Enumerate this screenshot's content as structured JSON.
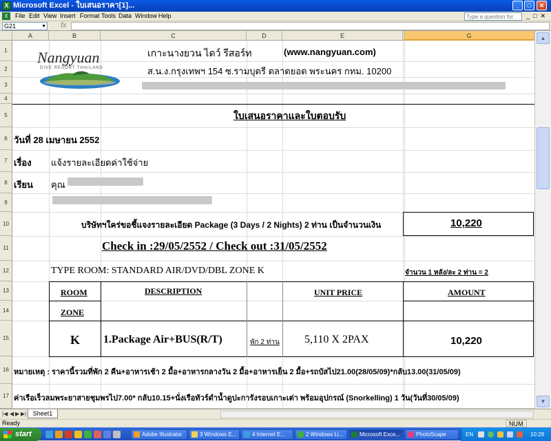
{
  "window": {
    "title": "Microsoft Excel - ใบเสนอราคา[1]..."
  },
  "menu": {
    "items": [
      "File",
      "Edit",
      "View",
      "Insert",
      "Format",
      "Tools",
      "Data",
      "Window",
      "Help"
    ],
    "help_placeholder": "Type a question for help"
  },
  "formula": {
    "cell_ref": "G21",
    "fx": "fx",
    "content": ""
  },
  "columns": [
    "A",
    "B",
    "C",
    "D",
    "E",
    "F",
    "G"
  ],
  "rows": [
    "1",
    "2",
    "3",
    "4",
    "5",
    "6",
    "7",
    "8",
    "9",
    "10",
    "11",
    "12",
    "13",
    "14",
    "15",
    "16",
    "17"
  ],
  "company": {
    "logo_text": "Nangyuan",
    "logo_sub": "DIVE RESORT THAILAND",
    "name": "เกาะนางยวน ไดว์ รีสอร์ท",
    "website": "(www.nangyuan.com)",
    "address": "ส.น.ง.กรุงเทพฯ 154 ซ.รามบุตรี ตลาดยอด พระนคร กทม. 10200"
  },
  "doc": {
    "heading": "ใบเสนอราคาและใบตอบรับ",
    "date": "วันที่ 28 เมษายน 2552",
    "subject_label": "เรื่อง",
    "subject": "แจ้งรายละเอียดค่าใช้จ่าย",
    "to_label": "เรียน",
    "to_prefix": "คุณ",
    "intro": "บริษัทฯใคร่ขอชี้แจงรายละเอียด Package (3 Days / 2 Nights) 2 ท่าน เป็นจำนวนเงิน",
    "total": "10,220",
    "checkin": "Check in :29/05/2552 / Check out :31/05/2552",
    "room_type": "TYPE ROOM: STANDARD AIR/DVD/DBL ZONE K",
    "room_count": "จำนวน 1 หลัง/ละ 2 ท่าน = 2"
  },
  "table": {
    "headers": {
      "room": "ROOM",
      "zone": "ZONE",
      "description": "DESCRIPTION",
      "unit_price": "UNIT PRICE",
      "amount": "AMOUNT"
    },
    "row": {
      "room": "K",
      "description": "1.Package Air+BUS(R/T)",
      "note": "พัก 2 ท่าน",
      "unit_price": "5,110 X 2PAX",
      "amount": "10,220"
    }
  },
  "notes": {
    "line16": "หมายเหตุ : ราคานี้รวมที่พัก 2 คืน+อาหารเช้า 2 มื้อ+อาหารกลางวัน 2 มื้อ+อาหารเย็น 2 มื้อ+รถบัสไป21.00(28/05/09)*กลับ13.00(31/05/09)",
    "line17": "ค่าเรือเร็วลมพระยาสายชุมพรไป7.00* กลับ10.15+นั่งเรือทัวร์ดำน้ำดูปะการังรอบเกาะเต่า พร้อมอุปกรณ์ (Snorkelling) 1 วัน(วันที่30/05/09)"
  },
  "sheet": {
    "tab": "Sheet1"
  },
  "status": {
    "left": "Ready",
    "num": "NUM"
  },
  "taskbar": {
    "start": "start",
    "tasks": [
      "Adobe Illustrator",
      "3 Windows E...",
      "4 Internet E...",
      "2 Windows Li...",
      "Microsoft Exce...",
      "PhotoScape"
    ],
    "lang": "EN",
    "time": "10:28"
  },
  "colors": {
    "title": "#0a46c8",
    "selected_col": "#f8c770",
    "taskbar": "#245edb",
    "start": "#3c9a3c"
  }
}
